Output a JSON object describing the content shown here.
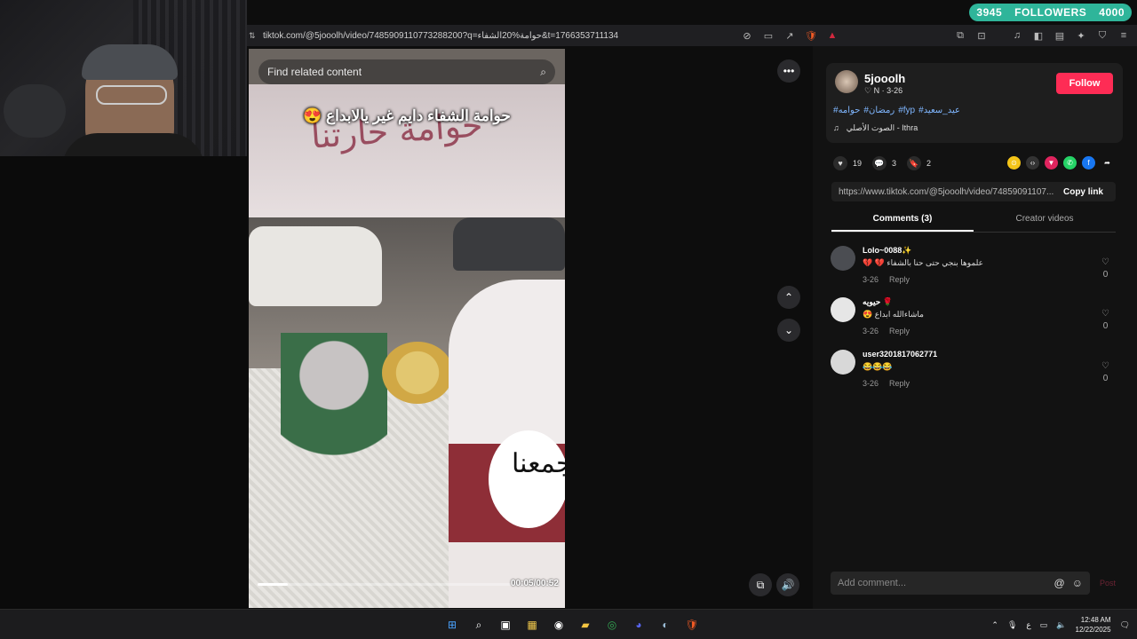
{
  "overlay": {
    "followers_current": "3945",
    "followers_label": "FOLLOWERS",
    "followers_goal": "4000"
  },
  "browser": {
    "url": "tiktok.com/@5jooolh/video/7485909110773288200?q=حوامة%20الشفاء&t=1766353711134",
    "icons": [
      "reader-off-icon",
      "tv-icon",
      "share-icon",
      "brave-shield-icon",
      "brave-rewards-icon",
      "extensions-icon",
      "screenshot-icon",
      "music-icon",
      "sidebar-icon",
      "wallet-icon",
      "leo-icon",
      "vpn-icon",
      "menu-icon"
    ]
  },
  "video": {
    "search_placeholder": "Find related content",
    "caption": "حوامة الشفاء دايم غير يالابداع 😍",
    "banner_text": "حوامة حارتنا",
    "moon_text": "تجمعنا",
    "time": "00:05/00:52",
    "progress": 0.1
  },
  "profile": {
    "username": "5jooolh",
    "subline": "♡ N · 3-26",
    "follow_label": "Follow",
    "hashtags": [
      "#حوامه",
      "#رمضان",
      "#fyp",
      "#عيد_سعيد"
    ],
    "music": "الصوت الأصلي - Ithra"
  },
  "actions": {
    "likes": "19",
    "comments": "3",
    "saves": "2"
  },
  "link": {
    "url": "https://www.tiktok.com/@5jooolh/video/74859091107...",
    "copy_label": "Copy link"
  },
  "tabs": {
    "comments": "Comments (3)",
    "creator": "Creator videos"
  },
  "comments": [
    {
      "name": "Lolo~0088✨",
      "text": "💔 💔 علموها بنجي حتى حنا بالشفاء",
      "date": "3-26",
      "reply": "Reply",
      "likes": "0"
    },
    {
      "name": "حيويه 🌹",
      "text": "😍 ماشاءالله ابداع",
      "date": "3-26",
      "reply": "Reply",
      "likes": "0"
    },
    {
      "name": "user3201817062771",
      "text": "😂😂😂",
      "date": "3-26",
      "reply": "Reply",
      "likes": "0"
    }
  ],
  "comment_input": {
    "placeholder": "Add comment...",
    "post_label": "Post"
  },
  "taskbar": {
    "time": "12:48 AM",
    "date": "12/22/2025",
    "lang": "ع"
  }
}
